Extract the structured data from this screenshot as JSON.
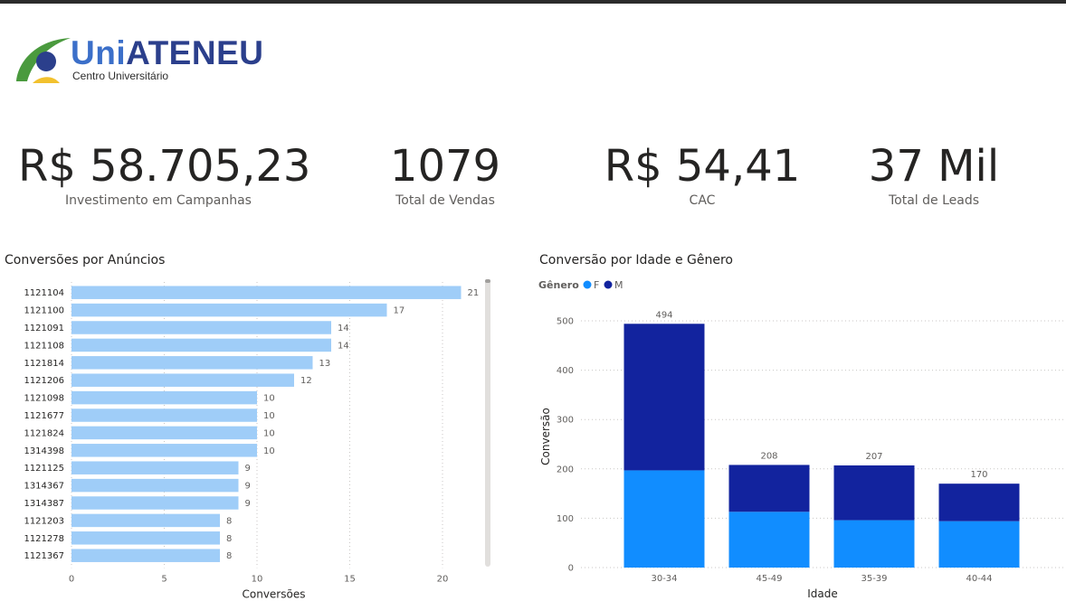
{
  "logo": {
    "name_part1": "Uni",
    "name_part2": "ATENEU",
    "subtitle": "Centro Universitário"
  },
  "kpis": [
    {
      "value": "R$ 58.705,23",
      "label": "Investimento em Campanhas"
    },
    {
      "value": "1079",
      "label": "Total de Vendas"
    },
    {
      "value": "R$ 54,41",
      "label": "CAC"
    },
    {
      "value": "37 Mil",
      "label": "Total de Leads"
    }
  ],
  "colors": {
    "bar_light": "#9fcdf8",
    "female": "#118dff",
    "male": "#12239e",
    "grid": "#c8c6c4",
    "text": "#252423",
    "muted": "#605e5c"
  },
  "chart_data": [
    {
      "type": "bar",
      "orientation": "horizontal",
      "title": "Conversões por Anúncios",
      "categories": [
        "1121104",
        "1121100",
        "1121091",
        "1121108",
        "1121814",
        "1121206",
        "1121098",
        "1121677",
        "1121824",
        "1314398",
        "1121125",
        "1314367",
        "1314387",
        "1121203",
        "1121278",
        "1121367"
      ],
      "values": [
        21,
        17,
        14,
        14,
        13,
        12,
        10,
        10,
        10,
        10,
        9,
        9,
        9,
        8,
        8,
        8
      ],
      "xlabel": "Conversões",
      "ylabel": "",
      "xlim": [
        0,
        22
      ],
      "xticks": [
        0,
        5,
        10,
        15,
        20
      ],
      "grid": true
    },
    {
      "type": "bar",
      "stacked": true,
      "title": "Conversão por Idade e Gênero",
      "legend_title": "Gênero",
      "legend_position": "top-left",
      "categories": [
        "30-34",
        "45-49",
        "35-39",
        "40-44"
      ],
      "series": [
        {
          "name": "F",
          "values": [
            197,
            113,
            96,
            94
          ]
        },
        {
          "name": "M",
          "values": [
            297,
            95,
            111,
            76
          ]
        }
      ],
      "totals": [
        494,
        208,
        207,
        170
      ],
      "xlabel": "Idade",
      "ylabel": "Conversão",
      "ylim": [
        0,
        500
      ],
      "yticks": [
        0,
        100,
        200,
        300,
        400,
        500
      ],
      "grid": true
    }
  ]
}
